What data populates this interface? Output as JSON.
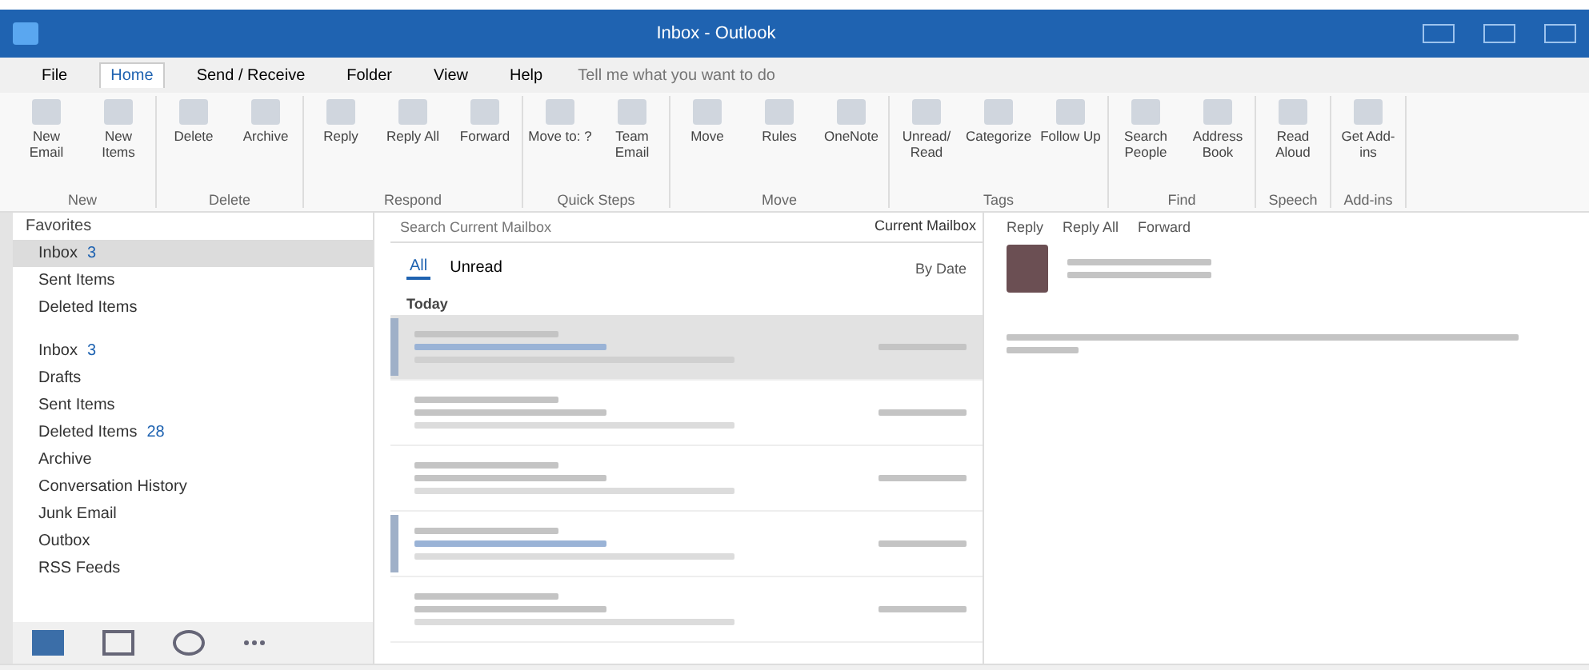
{
  "window": {
    "title": "Inbox - Outlook"
  },
  "tabs": [
    {
      "label": "File",
      "selected": false
    },
    {
      "label": "Home",
      "selected": true
    },
    {
      "label": "Send / Receive",
      "selected": false
    },
    {
      "label": "Folder",
      "selected": false
    },
    {
      "label": "View",
      "selected": false
    },
    {
      "label": "Help",
      "selected": false
    }
  ],
  "tell_me": {
    "placeholder": "Tell me what you want to do"
  },
  "ribbon_groups": [
    {
      "label": "New",
      "buttons": [
        "New Email",
        "New Items"
      ]
    },
    {
      "label": "Delete",
      "buttons": [
        "Delete",
        "Archive"
      ]
    },
    {
      "label": "Respond",
      "buttons": [
        "Reply",
        "Reply All",
        "Forward"
      ]
    },
    {
      "label": "Quick Steps",
      "buttons": [
        "Move to: ?",
        "Team Email"
      ]
    },
    {
      "label": "Move",
      "buttons": [
        "Move",
        "Rules",
        "OneNote"
      ]
    },
    {
      "label": "Tags",
      "buttons": [
        "Unread/ Read",
        "Categorize",
        "Follow Up"
      ]
    },
    {
      "label": "Find",
      "buttons": [
        "Search People",
        "Address Book"
      ]
    },
    {
      "label": "Speech",
      "buttons": [
        "Read Aloud"
      ]
    },
    {
      "label": "Add-ins",
      "buttons": [
        "Get Add-ins"
      ]
    }
  ],
  "favorites": {
    "label": "Favorites",
    "items": [
      {
        "label": "Inbox",
        "count": "3",
        "selected": true
      },
      {
        "label": "Sent Items",
        "selected": false
      },
      {
        "label": "Deleted Items",
        "selected": false
      }
    ]
  },
  "folders": [
    {
      "label": "Inbox",
      "count": "3"
    },
    {
      "label": "Drafts"
    },
    {
      "label": "Sent Items"
    },
    {
      "label": "Deleted Items",
      "count": "28"
    },
    {
      "label": "Archive"
    },
    {
      "label": "Conversation History"
    },
    {
      "label": "Junk Email"
    },
    {
      "label": "Outbox"
    },
    {
      "label": "RSS Feeds"
    }
  ],
  "search": {
    "placeholder": "Search Current Mailbox",
    "scope": "Current Mailbox"
  },
  "filters": [
    {
      "label": "All",
      "selected": true
    },
    {
      "label": "Unread",
      "selected": false
    }
  ],
  "sort": "By Date",
  "group_header": "Today",
  "messages": [
    {
      "selected": true,
      "unread": true
    },
    {
      "selected": false,
      "unread": false
    },
    {
      "selected": false,
      "unread": false
    },
    {
      "selected": false,
      "unread": true
    },
    {
      "selected": false,
      "unread": false
    }
  ],
  "reading_actions": [
    "Reply",
    "Reply All",
    "Forward"
  ]
}
